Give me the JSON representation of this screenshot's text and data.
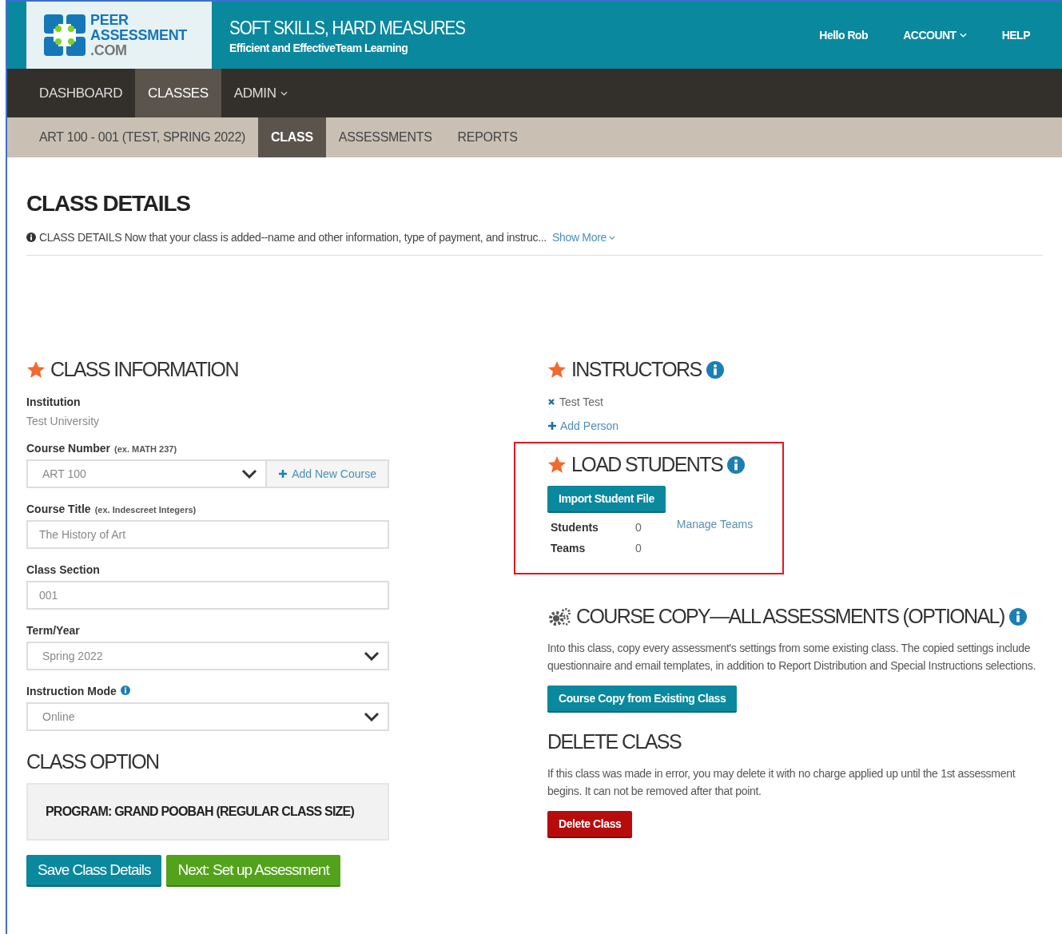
{
  "header": {
    "logo": [
      "PEER",
      "ASSESSMENT",
      ".COM"
    ],
    "title": "SOFT SKILLS, HARD MEASURES",
    "subtitle": "Efficient and EffectiveTeam Learning",
    "links": [
      {
        "label": "Hello Rob",
        "dropdown": false
      },
      {
        "label": "ACCOUNT",
        "dropdown": true
      },
      {
        "label": "HELP",
        "dropdown": false
      }
    ]
  },
  "nav": [
    {
      "label": "DASHBOARD",
      "selected": false,
      "dropdown": false
    },
    {
      "label": "CLASSES",
      "selected": true,
      "dropdown": false
    },
    {
      "label": "ADMIN",
      "selected": false,
      "dropdown": true
    }
  ],
  "subnav": [
    {
      "label": "ART 100 - 001 (TEST, SPRING 2022)",
      "selected": false
    },
    {
      "label": "CLASS",
      "selected": true
    },
    {
      "label": "ASSESSMENTS",
      "selected": false
    },
    {
      "label": "REPORTS",
      "selected": false
    }
  ],
  "page_title": "CLASS DETAILS",
  "info": {
    "text": "CLASS DETAILS Now that your class is added--name and other information, type of payment, and instruc...",
    "link": "Show More"
  },
  "class_information": {
    "title": "CLASS INFORMATION",
    "institution": {
      "label": "Institution",
      "value": "Test University"
    },
    "fields": [
      {
        "kind": "select_button",
        "label": "Course Number",
        "hint": "(ex. MATH 237)",
        "value": "ART 100",
        "button": "Add New Course"
      },
      {
        "kind": "input",
        "label": "Course Title",
        "hint": "(ex. Indescreet Integers)",
        "value": "The History of Art"
      },
      {
        "kind": "input",
        "label": "Class Section",
        "value": "001"
      },
      {
        "kind": "select",
        "label": "Term/Year",
        "value": "Spring 2022"
      },
      {
        "kind": "select",
        "label": "Instruction Mode",
        "value": "Online",
        "info": true
      }
    ]
  },
  "class_option": {
    "title": "CLASS OPTION",
    "program": "PROGRAM: GRAND POOBAH (REGULAR CLASS SIZE)"
  },
  "actions": [
    {
      "label": "Save Class Details",
      "kind": "primary"
    },
    {
      "label": "Next: Set up Assessment",
      "kind": "success"
    }
  ],
  "instructors": {
    "title": "INSTRUCTORS",
    "people": [
      "Test Test"
    ],
    "add_link": "Add Person"
  },
  "load_students": {
    "title": "LOAD STUDENTS",
    "highlighted": true,
    "button": "Import Student File",
    "stats": [
      {
        "label": "Students",
        "value": "0"
      },
      {
        "label": "Teams",
        "value": "0"
      }
    ],
    "link": "Manage Teams"
  },
  "course_copy": {
    "title": "COURSE COPY—ALL ASSESSMENTS (OPTIONAL)",
    "description": "Into this class, copy every assessment's settings from some existing class. The copied settings include questionnaire and email templates, in addition to Report Distribution and Special Instructions selections.",
    "button": "Course Copy from Existing Class"
  },
  "delete_class": {
    "title": "DELETE CLASS",
    "description": "If this class was made in error, you may delete it with no charge applied up until the 1st assessment begins. It can not be removed after that point.",
    "button": "Delete Class"
  }
}
